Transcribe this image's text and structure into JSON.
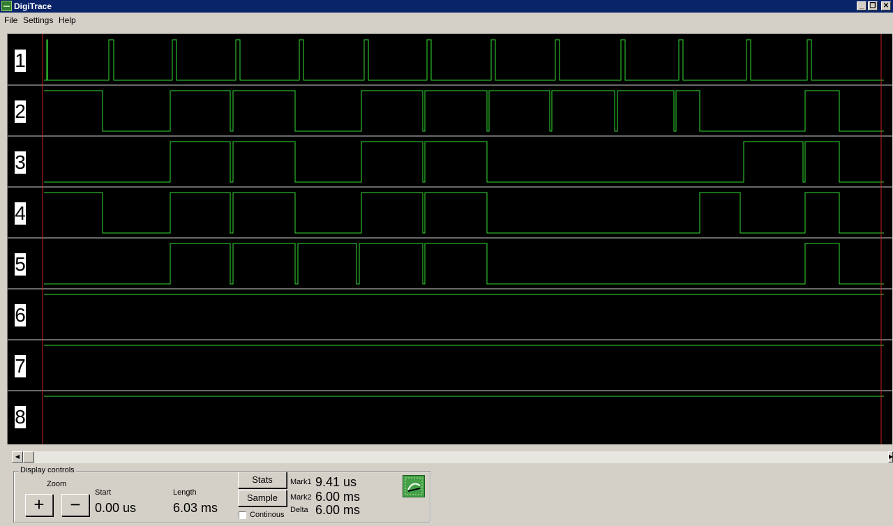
{
  "window": {
    "title": "DigiTrace",
    "min": "_",
    "restore": "❐",
    "close": "✕"
  },
  "menu": {
    "file": "File",
    "settings": "Settings",
    "help": "Help"
  },
  "trace_color": "#33dd33",
  "marker_color": "#cc2222",
  "channels": [
    {
      "label": "1",
      "transitions": [
        [
          4,
          1
        ],
        [
          5,
          0
        ],
        [
          93,
          1
        ],
        [
          100,
          0
        ],
        [
          184,
          1
        ],
        [
          190,
          0
        ],
        [
          275,
          1
        ],
        [
          281,
          0
        ],
        [
          366,
          1
        ],
        [
          372,
          0
        ],
        [
          459,
          1
        ],
        [
          465,
          0
        ],
        [
          549,
          1
        ],
        [
          555,
          0
        ],
        [
          641,
          1
        ],
        [
          647,
          0
        ],
        [
          733,
          1
        ],
        [
          739,
          0
        ],
        [
          827,
          1
        ],
        [
          833,
          0
        ],
        [
          910,
          1
        ],
        [
          916,
          0
        ],
        [
          1007,
          1
        ],
        [
          1013,
          0
        ],
        [
          1094,
          1
        ],
        [
          1100,
          0
        ]
      ],
      "initial": 0
    },
    {
      "label": "2",
      "transitions": [
        [
          84,
          0
        ],
        [
          181,
          1
        ],
        [
          267,
          0
        ],
        [
          271,
          1
        ],
        [
          360,
          0
        ],
        [
          455,
          1
        ],
        [
          543,
          0
        ],
        [
          546,
          1
        ],
        [
          635,
          0
        ],
        [
          638,
          1
        ],
        [
          725,
          0
        ],
        [
          728,
          1
        ],
        [
          818,
          0
        ],
        [
          822,
          1
        ],
        [
          903,
          0
        ],
        [
          906,
          1
        ],
        [
          940,
          0
        ],
        [
          1091,
          1
        ],
        [
          1140,
          0
        ]
      ],
      "initial": 1
    },
    {
      "label": "3",
      "transitions": [
        [
          181,
          1
        ],
        [
          267,
          0
        ],
        [
          271,
          1
        ],
        [
          360,
          0
        ],
        [
          455,
          1
        ],
        [
          543,
          0
        ],
        [
          546,
          1
        ],
        [
          635,
          0
        ],
        [
          1003,
          1
        ],
        [
          1088,
          0
        ],
        [
          1091,
          1
        ],
        [
          1140,
          0
        ]
      ],
      "initial": 0
    },
    {
      "label": "4",
      "transitions": [
        [
          84,
          0
        ],
        [
          181,
          1
        ],
        [
          267,
          0
        ],
        [
          271,
          1
        ],
        [
          360,
          0
        ],
        [
          455,
          1
        ],
        [
          543,
          0
        ],
        [
          546,
          1
        ],
        [
          635,
          0
        ],
        [
          940,
          1
        ],
        [
          998,
          0
        ],
        [
          1091,
          1
        ],
        [
          1140,
          0
        ]
      ],
      "initial": 1
    },
    {
      "label": "5",
      "transitions": [
        [
          181,
          1
        ],
        [
          267,
          0
        ],
        [
          271,
          1
        ],
        [
          360,
          0
        ],
        [
          364,
          1
        ],
        [
          448,
          0
        ],
        [
          452,
          1
        ],
        [
          543,
          0
        ],
        [
          546,
          1
        ],
        [
          635,
          0
        ],
        [
          1091,
          1
        ],
        [
          1140,
          0
        ]
      ],
      "initial": 0
    },
    {
      "label": "6",
      "transitions": [],
      "initial": 1
    },
    {
      "label": "7",
      "transitions": [],
      "initial": 1
    },
    {
      "label": "8",
      "transitions": [],
      "initial": 1
    }
  ],
  "controls": {
    "legend": "Display controls",
    "zoom_label": "Zoom",
    "zoom_in": "+",
    "zoom_out": "−",
    "start_label": "Start",
    "start_value": "0.00 us",
    "length_label": "Length",
    "length_value": "6.03 ms",
    "stats_button": "Stats",
    "sample_button": "Sample",
    "continous_label": "Continous",
    "continous_checked": false,
    "mark1_label": "Mark1",
    "mark1_value": "9.41 us",
    "mark2_label": "Mark2",
    "mark2_value": "6.00 ms",
    "delta_label": "Delta",
    "delta_value": "6.00 ms"
  },
  "icons": [
    "app-icon",
    "minimize-icon",
    "restore-icon",
    "close-icon",
    "scroll-left-icon",
    "scroll-right-icon",
    "logo-icon"
  ]
}
